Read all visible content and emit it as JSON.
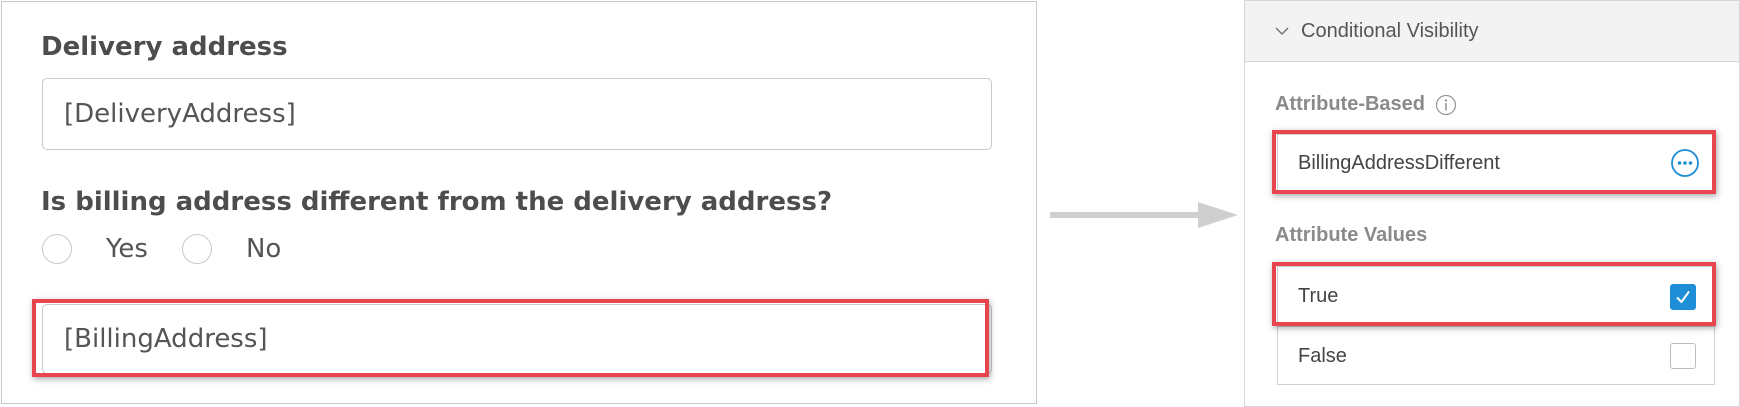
{
  "form": {
    "delivery_label": "Delivery address",
    "delivery_value": "[DeliveryAddress]",
    "billing_question": "Is billing address different from the delivery address?",
    "options": [
      {
        "label": "Yes",
        "selected": false
      },
      {
        "label": "No",
        "selected": false
      }
    ],
    "billing_value": "[BillingAddress]"
  },
  "properties": {
    "section_title": "Conditional Visibility",
    "attribute_based_label": "Attribute-Based",
    "attribute_value": "BillingAddressDifferent",
    "attribute_values_label": "Attribute Values",
    "values": [
      {
        "label": "True",
        "checked": true
      },
      {
        "label": "False",
        "checked": false
      }
    ]
  },
  "colors": {
    "highlight": "#e8454f",
    "accent": "#1e8fd6"
  },
  "icons": [
    "chevron-down-icon",
    "info-icon",
    "more-options-icon",
    "checkmark-icon",
    "arrow-right-icon"
  ]
}
